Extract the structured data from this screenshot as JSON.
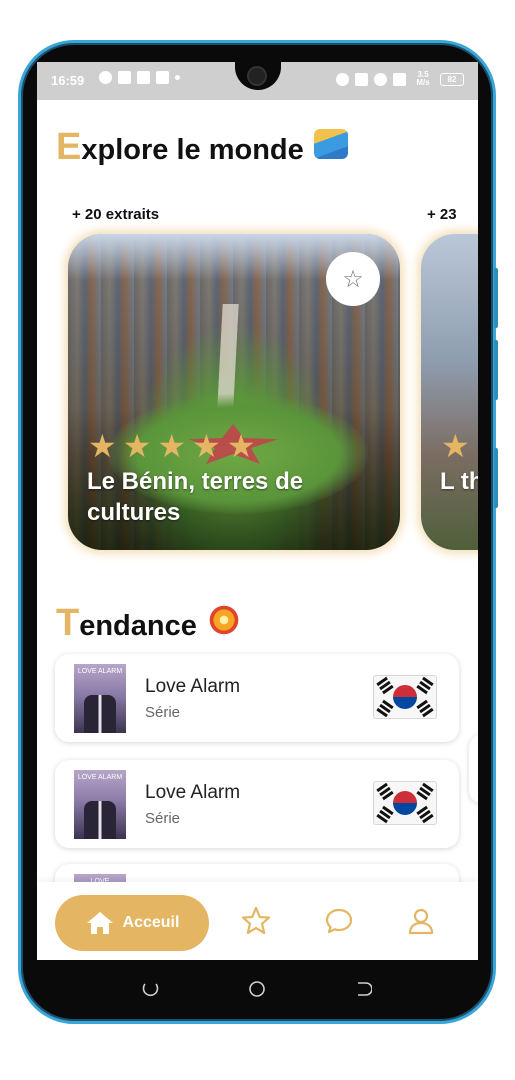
{
  "status_bar": {
    "time": "16:59",
    "net_speed": "3.5 M/s",
    "battery": "82"
  },
  "explore": {
    "title_first": "E",
    "title_rest": "xplore le monde",
    "emoji_icon": "surfer-emoji"
  },
  "carousel": {
    "cards": [
      {
        "count": "+ 20 extraits",
        "title": "Le Bénin, terres de cultures",
        "rating": 5
      },
      {
        "count": "+ 23",
        "title": "L th",
        "rating": 1
      }
    ]
  },
  "trend": {
    "title_first": "T",
    "title_rest": "endance",
    "emoji_icon": "collision-emoji",
    "items": [
      {
        "title": "Love Alarm",
        "subtitle": "Série",
        "poster_text": "LOVE ALARM",
        "flag": "south-korea"
      },
      {
        "title": "Love Alarm",
        "subtitle": "Série",
        "poster_text": "LOVE ALARM",
        "flag": "south-korea"
      },
      {
        "poster_text": "LOVE"
      }
    ]
  },
  "nav": {
    "home_label": "Acceuil",
    "accent": "#e4b663"
  }
}
